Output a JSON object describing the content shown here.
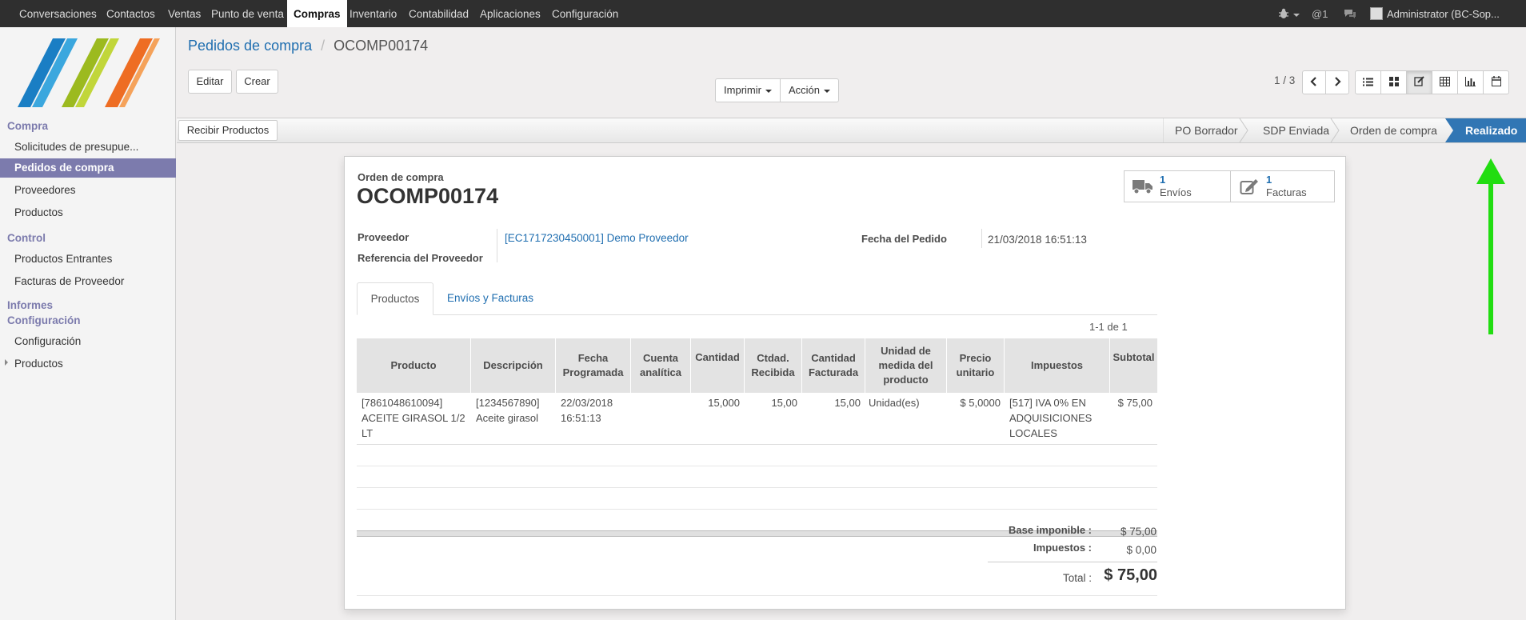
{
  "top_menu": {
    "items": [
      "Conversaciones",
      "Contactos",
      "Ventas",
      "Punto de venta",
      "Compras",
      "Inventario",
      "Contabilidad",
      "Aplicaciones",
      "Configuración"
    ],
    "active": "Compras",
    "systray": {
      "messages_count": "1",
      "user": "Administrator (BC-Sop..."
    }
  },
  "sidebar": {
    "sections": [
      {
        "title": "Compra",
        "items": [
          "Solicitudes de presupue...",
          "Pedidos de compra",
          "Proveedores",
          "Productos"
        ]
      },
      {
        "title": "Control",
        "items": [
          "Productos Entrantes",
          "Facturas de Proveedor"
        ]
      },
      {
        "title": "Informes"
      },
      {
        "title": "Configuración",
        "items": [
          "Configuración",
          "Productos"
        ]
      }
    ],
    "active_item": "Pedidos de compra"
  },
  "breadcrumb": {
    "parent": "Pedidos de compra",
    "separator": "/",
    "current": "OCOMP00174"
  },
  "buttons": {
    "edit": "Editar",
    "create": "Crear",
    "print": "Imprimir",
    "action": "Acción",
    "receive": "Recibir Productos"
  },
  "pager": {
    "value": "1 / 3"
  },
  "status_stages": [
    "PO Borrador",
    "SDP Enviada",
    "Orden de compra",
    "Realizado"
  ],
  "status_active": "Realizado",
  "sheet": {
    "doc_label": "Orden de compra",
    "doc_number": "OCOMP00174",
    "smart_buttons": [
      {
        "count": "1",
        "label": "Envíos",
        "icon": "truck-icon"
      },
      {
        "count": "1",
        "label": "Facturas",
        "icon": "edit-icon"
      }
    ],
    "fields": {
      "proveedor_label": "Proveedor",
      "proveedor_value": "[EC1717230450001] Demo Proveedor",
      "ref_label": "Referencia del Proveedor",
      "fecha_label": "Fecha del Pedido",
      "fecha_value": "21/03/2018 16:51:13"
    },
    "tabs": [
      "Productos",
      "Envíos y Facturas"
    ],
    "active_tab": "Productos",
    "list_pager": "1-1 de 1",
    "table": {
      "headers": [
        "Producto",
        "Descripción",
        "Fecha Programada",
        "Cuenta analítica",
        "Cantidad",
        "Ctdad. Recibida",
        "Cantidad Facturada",
        "Unidad de medida del producto",
        "Precio unitario",
        "Impuestos",
        "Subtotal"
      ],
      "rows": [
        {
          "producto": "[7861048610094] ACEITE GIRASOL 1/2 LT",
          "descripcion": "[1234567890] Aceite girasol",
          "fecha": "22/03/2018 16:51:13",
          "cuenta": "",
          "cantidad": "15,000",
          "recibida": "15,00",
          "facturada": "15,00",
          "unidad": "Unidad(es)",
          "precio": "$ 5,0000",
          "impuestos": "[517] IVA 0% EN ADQUISICIONES LOCALES",
          "subtotal": "$ 75,00"
        }
      ]
    },
    "totals": {
      "base_label": "Base imponible :",
      "base_value": "$ 75,00",
      "tax_label": "Impuestos :",
      "tax_value": "$ 0,00",
      "total_label": "Total :",
      "total_value": "$ 75,00"
    }
  },
  "colors": {
    "accent": "#7c7bad",
    "link": "#1f6eb0",
    "status_active": "#3176b4",
    "arrow": "#22dd11"
  }
}
